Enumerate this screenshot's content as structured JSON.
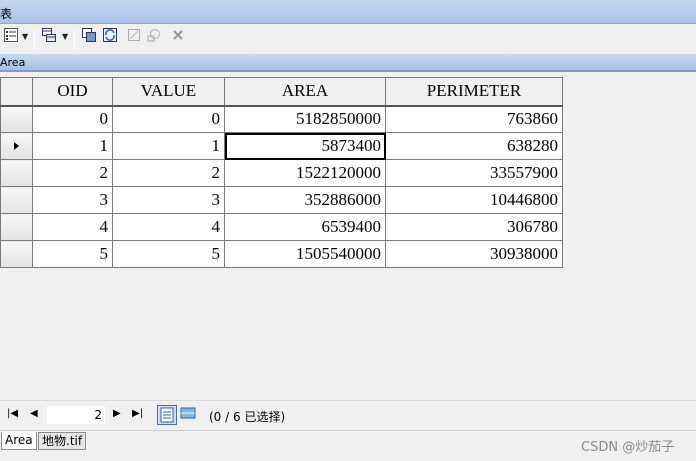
{
  "window": {
    "title": "表"
  },
  "table_tab": {
    "name": "Area"
  },
  "grid": {
    "columns": [
      "OID",
      "VALUE",
      "AREA",
      "PERIMETER"
    ],
    "rows": [
      [
        "0",
        "0",
        "5182850000",
        "763860"
      ],
      [
        "1",
        "1",
        "5873400",
        "638280"
      ],
      [
        "2",
        "2",
        "1522120000",
        "33557900"
      ],
      [
        "3",
        "3",
        "352886000",
        "10446800"
      ],
      [
        "4",
        "4",
        "6539400",
        "306780"
      ],
      [
        "5",
        "5",
        "1505540000",
        "30938000"
      ]
    ],
    "current_row": 1
  },
  "navigation": {
    "current_page": "2",
    "status": "(0 / 6 已选择)"
  },
  "tabs": [
    "Area",
    "地物.tif"
  ],
  "watermark": "CSDN @炒茄子"
}
